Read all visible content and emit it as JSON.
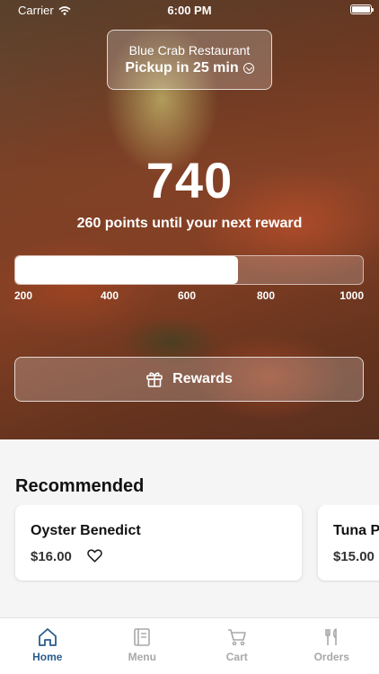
{
  "status_bar": {
    "carrier": "Carrier",
    "time": "6:00 PM"
  },
  "pickup": {
    "restaurant": "Blue Crab Restaurant",
    "pickup_time": "Pickup in 25 min",
    "icon": "chevron-down-circle-icon"
  },
  "loyalty": {
    "points": "740",
    "subtitle": "260 points until your next reward",
    "progress_percent": 64,
    "scale_ticks": [
      "200",
      "400",
      "600",
      "800",
      "1000"
    ],
    "rewards_label": "Rewards",
    "rewards_icon": "gift-icon"
  },
  "recommended": {
    "title": "Recommended",
    "items": [
      {
        "name": "Oyster Benedict",
        "price": "$16.00",
        "icon": "heart-icon"
      },
      {
        "name": "Tuna P",
        "price": "$15.00"
      }
    ]
  },
  "tab_bar": {
    "tabs": [
      {
        "label": "Home",
        "icon": "home-icon",
        "active": true
      },
      {
        "label": "Menu",
        "icon": "menu-icon",
        "active": false
      },
      {
        "label": "Cart",
        "icon": "cart-icon",
        "active": false
      },
      {
        "label": "Orders",
        "icon": "fork-knife-icon",
        "active": false
      }
    ]
  },
  "colors": {
    "accent": "#2a5c8c",
    "inactive": "#a8a8a8"
  }
}
